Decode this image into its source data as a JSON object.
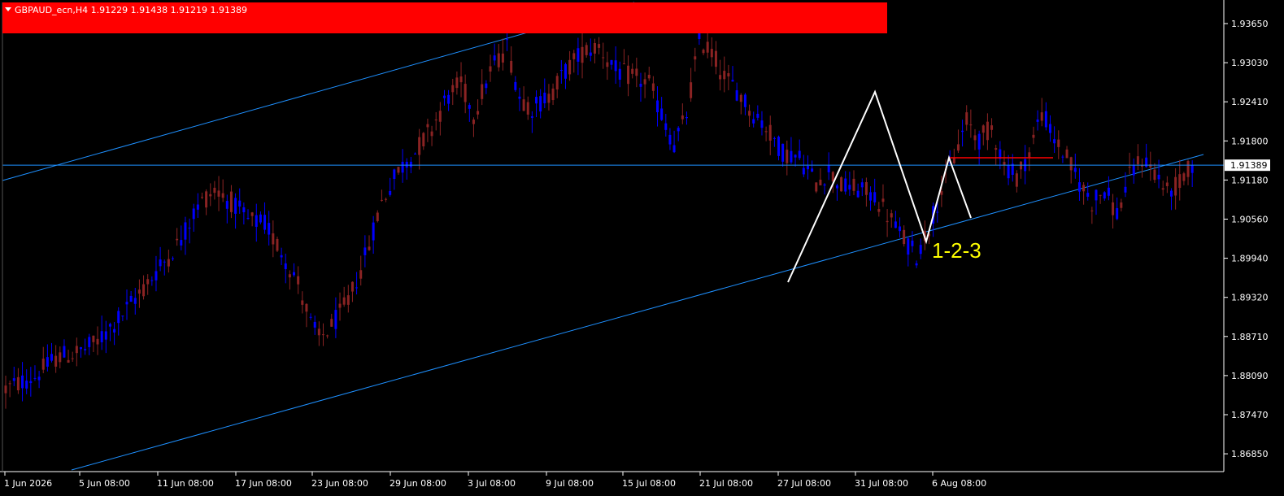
{
  "header": {
    "symbol_info": "GBPAUD_ecn,H4  1.91229 1.91438 1.91219 1.91389",
    "banner_color": "#ff0000"
  },
  "current_price_label": "1.91389",
  "pattern_label": "1-2-3",
  "colors": {
    "background": "#000000",
    "bull": "#0000ff",
    "bear": "#8b2323",
    "channel": "#1e90ff",
    "pattern": "#ffffff",
    "level": "#ff0000",
    "axis": "#ffffff",
    "pattern_text": "#ffff00"
  },
  "chart_data": {
    "type": "candlestick",
    "title": "GBPAUD_ecn,H4",
    "ohlc": {
      "open": 1.91229,
      "high": 1.91438,
      "low": 1.91219,
      "close": 1.91389
    },
    "ylim": [
      1.865,
      1.94
    ],
    "y_ticks": [
      "1.93650",
      "1.93030",
      "1.92410",
      "1.91800",
      "1.91180",
      "1.90560",
      "1.89940",
      "1.89320",
      "1.88710",
      "1.88090",
      "1.87470",
      "1.86850"
    ],
    "x_ticks": [
      "1 Jun 2026",
      "5 Jun 08:00",
      "11 Jun 08:00",
      "17 Jun 08:00",
      "23 Jun 08:00",
      "29 Jun 08:00",
      "3 Jul 08:00",
      "9 Jul 08:00",
      "15 Jul 08:00",
      "21 Jul 08:00",
      "27 Jul 08:00",
      "31 Jul 08:00",
      "6 Aug 08:00"
    ],
    "path_points": [
      [
        0,
        1.878
      ],
      [
        7,
        1.88
      ],
      [
        12,
        1.883
      ],
      [
        18,
        1.884
      ],
      [
        22,
        1.8855
      ],
      [
        28,
        1.89
      ],
      [
        34,
        1.895
      ],
      [
        38,
        1.8985
      ],
      [
        42,
        1.902
      ],
      [
        46,
        1.9075
      ],
      [
        50,
        1.91
      ],
      [
        54,
        1.908
      ],
      [
        58,
        1.905
      ],
      [
        62,
        1.9045
      ],
      [
        66,
        1.9
      ],
      [
        70,
        1.895
      ],
      [
        73,
        1.8885
      ],
      [
        75,
        1.886
      ],
      [
        78,
        1.888
      ],
      [
        82,
        1.892
      ],
      [
        86,
        1.899
      ],
      [
        90,
        1.908
      ],
      [
        94,
        1.913
      ],
      [
        98,
        1.916
      ],
      [
        102,
        1.92
      ],
      [
        106,
        1.925
      ],
      [
        109,
        1.927
      ],
      [
        112,
        1.922
      ],
      [
        116,
        1.929
      ],
      [
        120,
        1.933
      ],
      [
        123,
        1.925
      ],
      [
        126,
        1.923
      ],
      [
        130,
        1.925
      ],
      [
        134,
        1.929
      ],
      [
        138,
        1.932
      ],
      [
        142,
        1.933
      ],
      [
        146,
        1.929
      ],
      [
        150,
        1.928
      ],
      [
        154,
        1.927
      ],
      [
        157,
        1.922
      ],
      [
        160,
        1.917
      ],
      [
        163,
        1.922
      ],
      [
        166,
        1.934
      ],
      [
        169,
        1.932
      ],
      [
        172,
        1.928
      ],
      [
        175,
        1.926
      ],
      [
        178,
        1.923
      ],
      [
        182,
        1.92
      ],
      [
        186,
        1.916
      ],
      [
        190,
        1.915
      ],
      [
        194,
        1.911
      ],
      [
        197,
        1.913
      ],
      [
        200,
        1.9105
      ],
      [
        204,
        1.91
      ],
      [
        208,
        1.909
      ],
      [
        212,
        1.905
      ],
      [
        215,
        1.902
      ],
      [
        218,
        1.8995
      ],
      [
        221,
        1.904
      ],
      [
        224,
        1.91
      ],
      [
        227,
        1.915
      ],
      [
        230,
        1.921
      ],
      [
        233,
        1.918
      ],
      [
        236,
        1.92
      ],
      [
        239,
        1.914
      ],
      [
        242,
        1.912
      ],
      [
        245,
        1.916
      ],
      [
        248,
        1.9225
      ],
      [
        251,
        1.918
      ],
      [
        254,
        1.915
      ],
      [
        257,
        1.911
      ],
      [
        260,
        1.908
      ],
      [
        263,
        1.91
      ],
      [
        266,
        1.906
      ],
      [
        269,
        1.912
      ],
      [
        272,
        1.915
      ],
      [
        275,
        1.913
      ],
      [
        278,
        1.9095
      ],
      [
        281,
        1.911
      ],
      [
        284,
        1.9139
      ]
    ]
  }
}
